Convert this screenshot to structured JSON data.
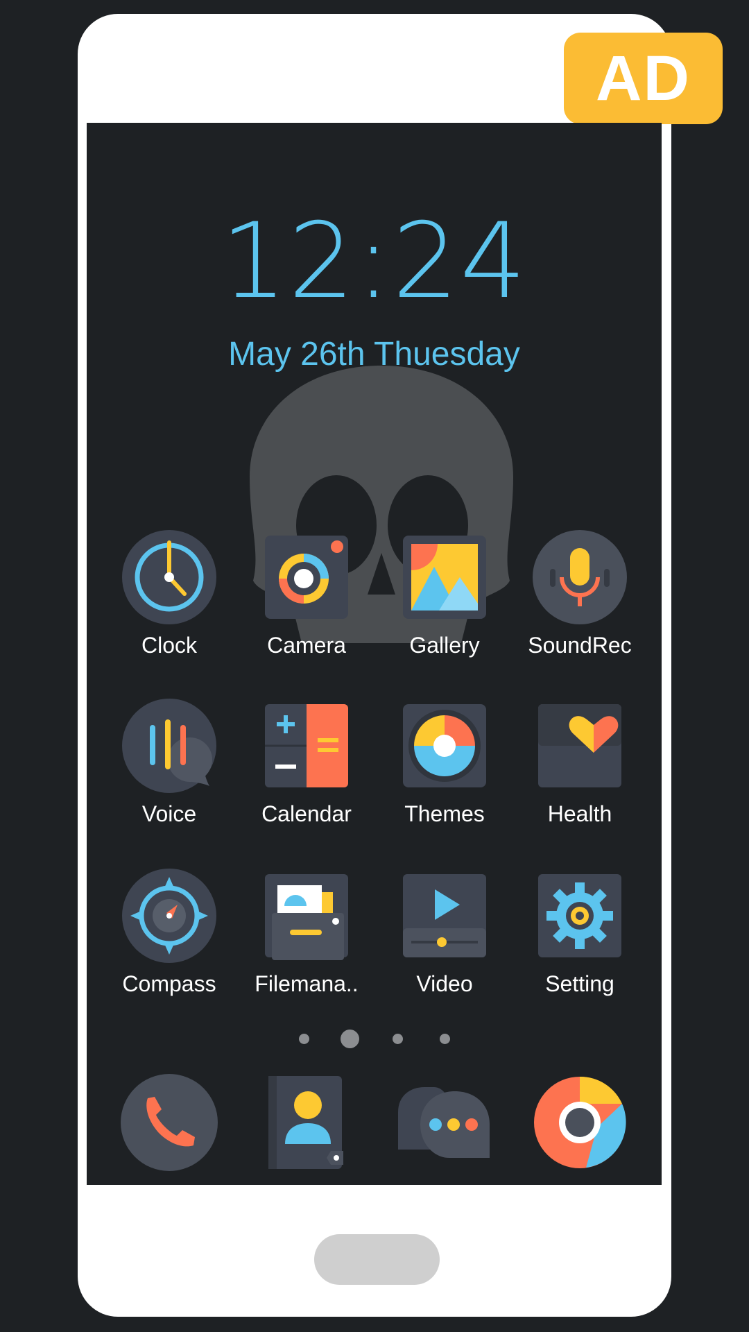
{
  "badge": {
    "label": "AD",
    "color": "#fbbc34"
  },
  "lockscreen": {
    "time": "12:24",
    "date": "May 26th Thuesday",
    "accent": "#5cc4ee"
  },
  "apps": [
    {
      "label": "Clock",
      "icon": "clock-icon"
    },
    {
      "label": "Camera",
      "icon": "camera-icon"
    },
    {
      "label": "Gallery",
      "icon": "gallery-icon"
    },
    {
      "label": "SoundRec",
      "icon": "microphone-icon"
    },
    {
      "label": "Voice",
      "icon": "voice-icon"
    },
    {
      "label": "Calendar",
      "icon": "calculator-icon"
    },
    {
      "label": "Themes",
      "icon": "themes-icon"
    },
    {
      "label": "Health",
      "icon": "heart-icon"
    },
    {
      "label": "Compass",
      "icon": "compass-icon"
    },
    {
      "label": "Filemana..",
      "icon": "file-manager-icon"
    },
    {
      "label": "Video",
      "icon": "video-play-icon"
    },
    {
      "label": "Setting",
      "icon": "gear-icon"
    }
  ],
  "pager": {
    "pages": 4,
    "current": 2
  },
  "dock": [
    {
      "icon": "phone-icon"
    },
    {
      "icon": "contacts-icon"
    },
    {
      "icon": "messages-icon"
    },
    {
      "icon": "browser-icon"
    }
  ],
  "colors": {
    "background": "#1e2124",
    "tile": "#3f4552",
    "orange": "#fd7350",
    "yellow": "#fdc932",
    "blue": "#5cc4ee"
  }
}
